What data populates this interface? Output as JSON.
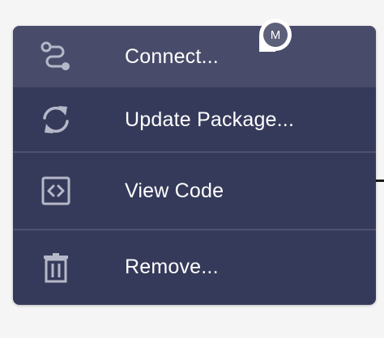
{
  "menu": {
    "items": [
      {
        "label": "Connect...",
        "icon": "connect-icon"
      },
      {
        "label": "Update Package...",
        "icon": "refresh-icon"
      },
      {
        "label": "View Code",
        "icon": "code-icon"
      },
      {
        "label": "Remove...",
        "icon": "trash-icon"
      }
    ]
  },
  "avatar": {
    "initial": "M"
  },
  "colors": {
    "menu_bg": "#363a5a",
    "hover_bg": "#484c6a",
    "icon": "#b5b8c8",
    "text": "#ffffff",
    "page_bg": "#f5f5f6"
  }
}
